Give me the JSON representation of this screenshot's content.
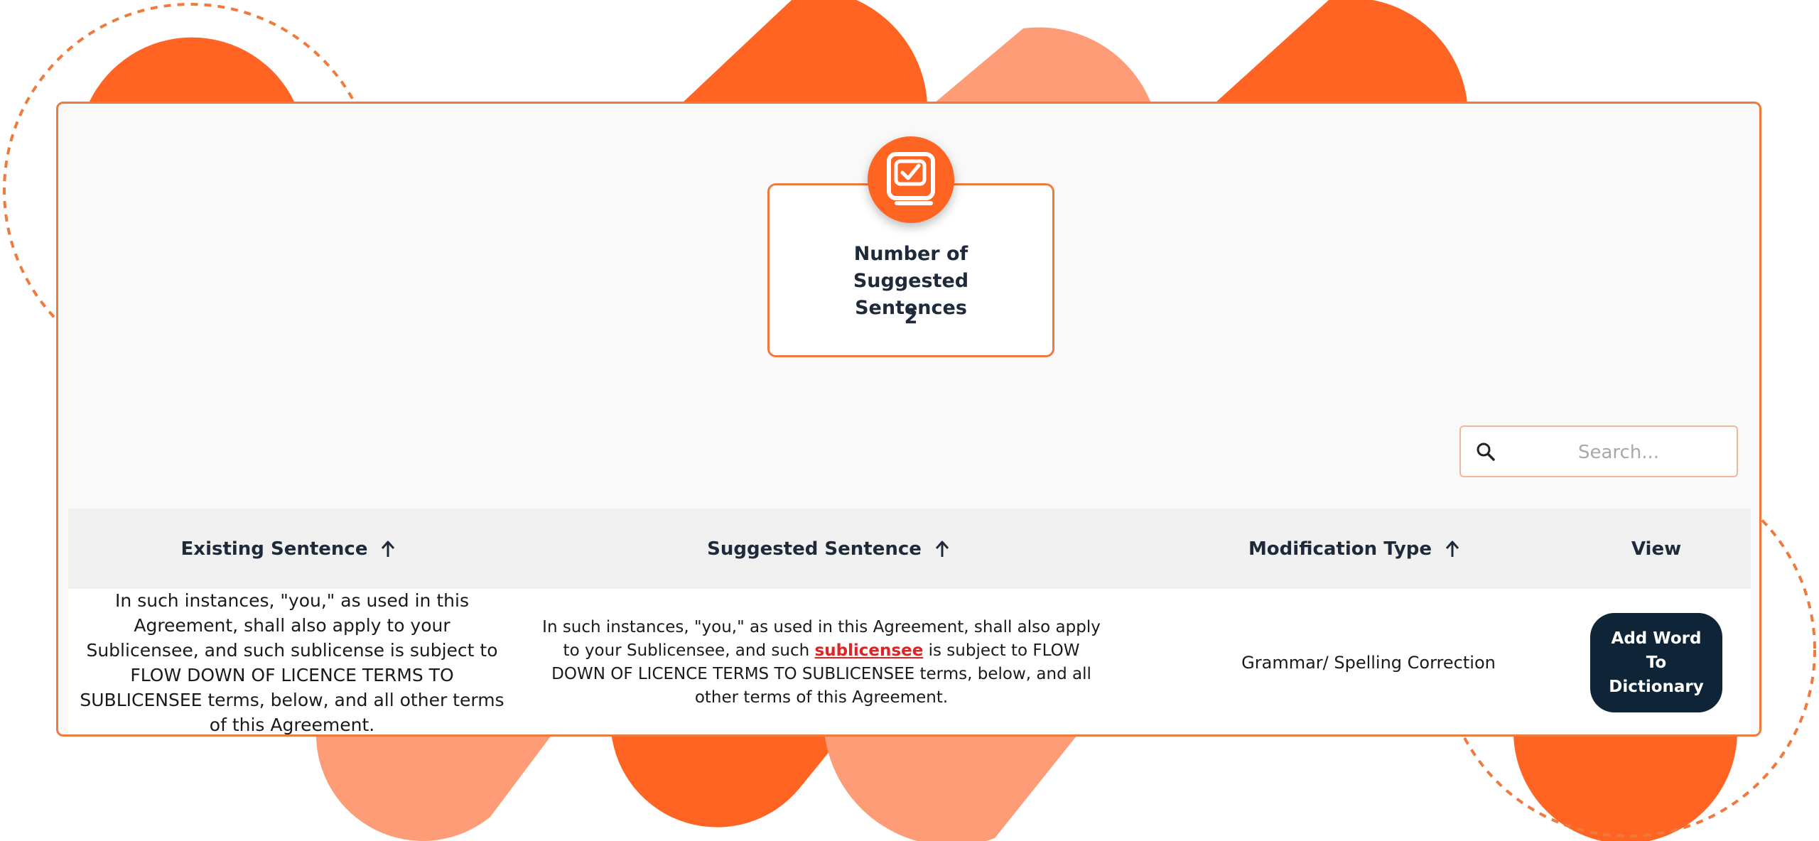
{
  "colors": {
    "accent": "#ff6422",
    "accent_light": "#fd9c77",
    "border": "#f07a3e",
    "dark_button": "#0f2537",
    "highlight": "#e02424"
  },
  "stat_card": {
    "icon": "book-check-icon",
    "label": "Number of Suggested Sentences",
    "value": "2"
  },
  "search": {
    "icon": "search-icon",
    "placeholder": "Search..."
  },
  "table": {
    "columns": [
      {
        "label": "Existing Sentence",
        "sortable": true
      },
      {
        "label": "Suggested Sentence",
        "sortable": true
      },
      {
        "label": "Modification Type",
        "sortable": true
      },
      {
        "label": "View",
        "sortable": false
      }
    ],
    "rows": [
      {
        "existing": "In such instances, \"you,\" as used in this Agreement, shall also apply to your Sublicensee, and such sublicense is subject to FLOW DOWN OF LICENCE TERMS TO SUBLICENSEE terms, below, and all other terms of this Agreement.",
        "suggested_before": "In such instances, \"you,\" as used in this Agreement, shall also apply to your Sublicensee, and such ",
        "suggested_highlight": "sublicensee",
        "suggested_after": " is subject to FLOW DOWN OF LICENCE TERMS TO SUBLICENSEE terms, below, and all other terms of this Agreement.",
        "modification_type": "Grammar/ Spelling Correction",
        "action_label": "Add Word To Dictionary"
      }
    ]
  }
}
